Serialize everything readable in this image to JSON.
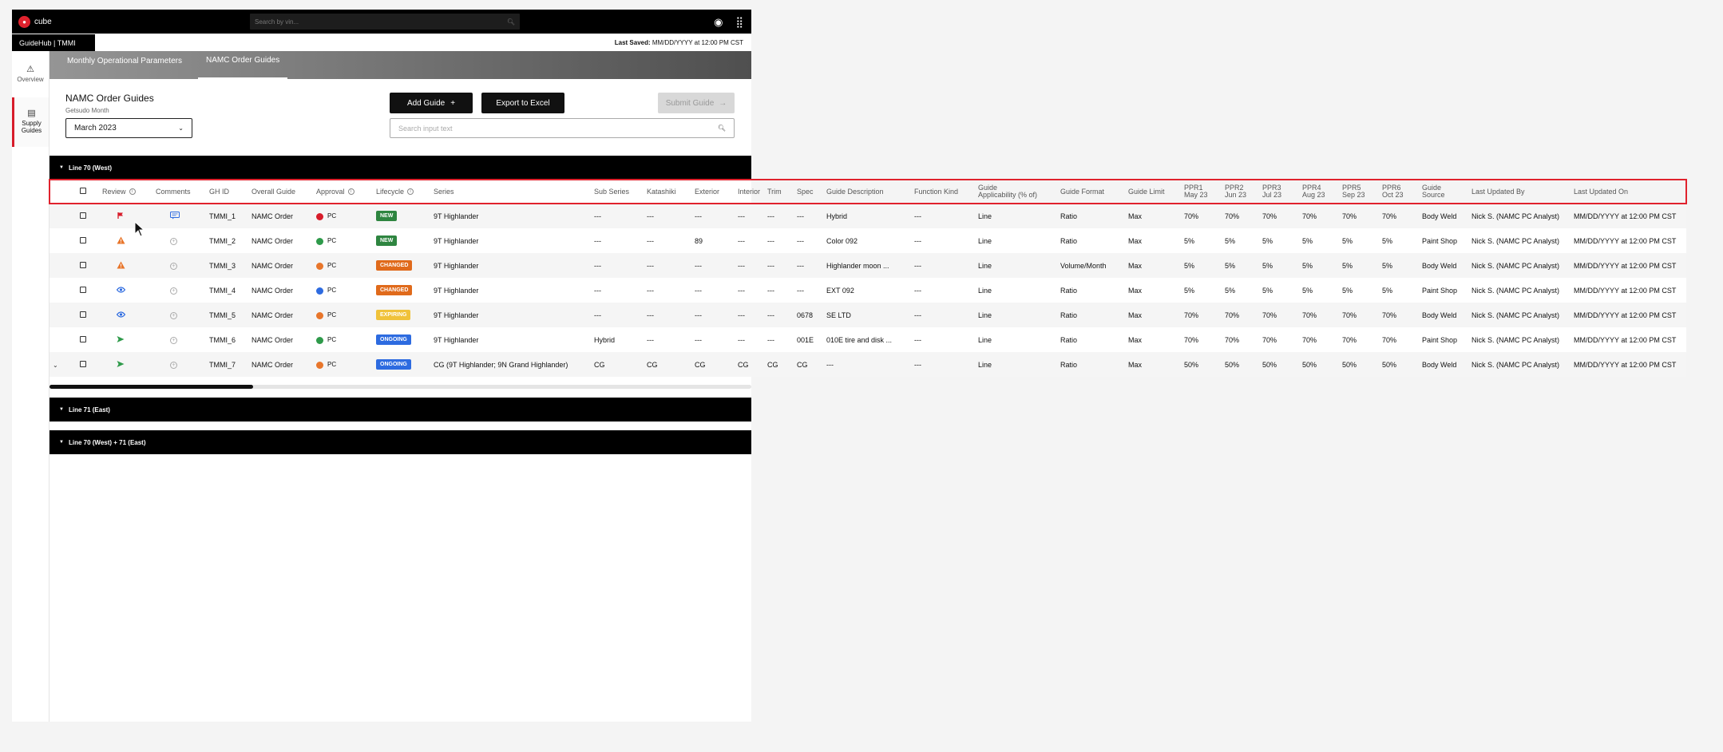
{
  "topbar": {
    "brand": "cube",
    "search_placeholder": "Search by vin...",
    "icons": [
      "user-circle-icon",
      "apps-grid-icon"
    ]
  },
  "subbar": {
    "app_name": "GuideHub | TMMI",
    "last_saved_label": "Last Saved:",
    "last_saved_value": "MM/DD/YYYY at 12:00 PM CST"
  },
  "sidebar": {
    "items": [
      {
        "label": "Overview",
        "icon": "overview-icon"
      },
      {
        "label": "Supply Guides",
        "icon": "document-icon"
      }
    ]
  },
  "tabs": [
    "Monthly Operational Parameters",
    "NAMC Order Guides"
  ],
  "panel": {
    "title": "NAMC Order Guides",
    "subtitle": "Getsudo Month",
    "month": "March 2023",
    "add_guide": "Add Guide",
    "export": "Export to Excel",
    "submit": "Submit Guide",
    "search_placeholder": "Search input text"
  },
  "groups": [
    "Line 70 (West)",
    "Line 71 (East)",
    "Line 70 (West) + 71 (East)"
  ],
  "table": {
    "headers": {
      "review": "Review",
      "comments": "Comments",
      "ghid": "GH ID",
      "overall": "Overall Guide",
      "approval": "Approval",
      "lifecycle": "Lifecycle",
      "series": "Series",
      "subseries": "Sub Series",
      "katashiki": "Katashiki",
      "exterior": "Exterior",
      "interior": "Interior",
      "trim": "Trim",
      "spec": "Spec",
      "desc": "Guide Description",
      "fkind": "Function Kind",
      "applic1": "Guide",
      "applic2": "Applicability (% of)",
      "format": "Guide Format",
      "limit": "Guide Limit",
      "ppr1a": "PPR1",
      "ppr1b": "May 23",
      "ppr2a": "PPR2",
      "ppr2b": "Jun 23",
      "ppr3a": "PPR3",
      "ppr3b": "Jul 23",
      "ppr4a": "PPR4",
      "ppr4b": "Aug 23",
      "ppr5a": "PPR5",
      "ppr5b": "Sep 23",
      "ppr6a": "PPR6",
      "ppr6b": "Oct 23",
      "source1": "Guide",
      "source2": "Source",
      "updated_by": "Last Updated By",
      "updated_on": "Last Updated On"
    },
    "rows": [
      {
        "review_icon": "flag-icon",
        "comment_icon": "chat-icon",
        "ghid": "TMMI_1",
        "overall": "NAMC Order",
        "approval_color": "#d71c2a",
        "approval": "PC",
        "lifecycle": "NEW",
        "lifecycle_color": "#2e8540",
        "series": "9T Highlander",
        "subseries": "---",
        "katashiki": "---",
        "exterior": "---",
        "interior": "---",
        "trim": "---",
        "spec": "---",
        "desc": "Hybrid",
        "fkind": "---",
        "applic": "Line",
        "format": "Ratio",
        "limit": "Max",
        "ppr": [
          "70%",
          "70%",
          "70%",
          "70%",
          "70%",
          "70%"
        ],
        "source": "Body Weld",
        "updated_by": "Nick S. (NAMC PC Analyst)",
        "updated_on": "MM/DD/YYYY at 12:00 PM CST"
      },
      {
        "review_icon": "warning-icon",
        "comment_icon": "add-comment-icon",
        "ghid": "TMMI_2",
        "overall": "NAMC Order",
        "approval_color": "#2e9a4a",
        "approval": "PC",
        "lifecycle": "NEW",
        "lifecycle_color": "#2e8540",
        "series": "9T Highlander",
        "subseries": "---",
        "katashiki": "---",
        "exterior": "89",
        "interior": "---",
        "trim": "---",
        "spec": "---",
        "desc": "Color 092",
        "fkind": "---",
        "applic": "Line",
        "format": "Ratio",
        "limit": "Max",
        "ppr": [
          "5%",
          "5%",
          "5%",
          "5%",
          "5%",
          "5%"
        ],
        "source": "Paint Shop",
        "updated_by": "Nick S. (NAMC PC Analyst)",
        "updated_on": "MM/DD/YYYY at 12:00 PM CST"
      },
      {
        "review_icon": "warning-icon",
        "comment_icon": "add-comment-icon",
        "ghid": "TMMI_3",
        "overall": "NAMC Order",
        "approval_color": "#e8762b",
        "approval": "PC",
        "lifecycle": "CHANGED",
        "lifecycle_color": "#e06a1b",
        "series": "9T Highlander",
        "subseries": "---",
        "katashiki": "---",
        "exterior": "---",
        "interior": "---",
        "trim": "---",
        "spec": "---",
        "desc": "Highlander moon ...",
        "fkind": "---",
        "applic": "Line",
        "format": "Volume/Month",
        "limit": "Max",
        "ppr": [
          "5%",
          "5%",
          "5%",
          "5%",
          "5%",
          "5%"
        ],
        "source": "Body Weld",
        "updated_by": "Nick S. (NAMC PC Analyst)",
        "updated_on": "MM/DD/YYYY at 12:00 PM CST"
      },
      {
        "review_icon": "eye-icon",
        "comment_icon": "add-comment-icon",
        "ghid": "TMMI_4",
        "overall": "NAMC Order",
        "approval_color": "#2d6be0",
        "approval": "PC",
        "lifecycle": "CHANGED",
        "lifecycle_color": "#e06a1b",
        "series": "9T Highlander",
        "subseries": "---",
        "katashiki": "---",
        "exterior": "---",
        "interior": "---",
        "trim": "---",
        "spec": "---",
        "desc": "EXT 092",
        "fkind": "---",
        "applic": "Line",
        "format": "Ratio",
        "limit": "Max",
        "ppr": [
          "5%",
          "5%",
          "5%",
          "5%",
          "5%",
          "5%"
        ],
        "source": "Paint Shop",
        "updated_by": "Nick S. (NAMC PC Analyst)",
        "updated_on": "MM/DD/YYYY at 12:00 PM CST"
      },
      {
        "review_icon": "eye-icon",
        "comment_icon": "add-comment-icon",
        "ghid": "TMMI_5",
        "overall": "NAMC Order",
        "approval_color": "#e8762b",
        "approval": "PC",
        "lifecycle": "EXPIRING",
        "lifecycle_color": "#f0c23a",
        "series": "9T Highlander",
        "subseries": "---",
        "katashiki": "---",
        "exterior": "---",
        "interior": "---",
        "trim": "---",
        "spec": "0678",
        "desc": "SE LTD",
        "fkind": "---",
        "applic": "Line",
        "format": "Ratio",
        "limit": "Max",
        "ppr": [
          "70%",
          "70%",
          "70%",
          "70%",
          "70%",
          "70%"
        ],
        "source": "Body Weld",
        "updated_by": "Nick S. (NAMC PC Analyst)",
        "updated_on": "MM/DD/YYYY at 12:00 PM CST"
      },
      {
        "review_icon": "send-icon",
        "comment_icon": "add-comment-icon",
        "ghid": "TMMI_6",
        "overall": "NAMC Order",
        "approval_color": "#2e9a4a",
        "approval": "PC",
        "lifecycle": "ONGOING",
        "lifecycle_color": "#2d6be0",
        "series": "9T Highlander",
        "subseries": "Hybrid",
        "katashiki": "---",
        "exterior": "---",
        "interior": "---",
        "trim": "---",
        "spec": "001E",
        "desc": "010E tire and disk ...",
        "fkind": "---",
        "applic": "Line",
        "format": "Ratio",
        "limit": "Max",
        "ppr": [
          "70%",
          "70%",
          "70%",
          "70%",
          "70%",
          "70%"
        ],
        "source": "Paint Shop",
        "updated_by": "Nick S. (NAMC PC Analyst)",
        "updated_on": "MM/DD/YYYY at 12:00 PM CST"
      },
      {
        "review_icon": "send-icon",
        "comment_icon": "add-comment-icon",
        "ghid": "TMMI_7",
        "overall": "NAMC Order",
        "approval_color": "#e8762b",
        "approval": "PC",
        "lifecycle": "ONGOING",
        "lifecycle_color": "#2d6be0",
        "series": "CG (9T Highlander; 9N Grand Highlander)",
        "subseries": "CG",
        "katashiki": "CG",
        "exterior": "CG",
        "interior": "CG",
        "trim": "CG",
        "spec": "CG",
        "desc": "---",
        "fkind": "---",
        "applic": "Line",
        "format": "Ratio",
        "limit": "Max",
        "ppr": [
          "50%",
          "50%",
          "50%",
          "50%",
          "50%",
          "50%"
        ],
        "source": "Body Weld",
        "updated_by": "Nick S. (NAMC PC Analyst)",
        "updated_on": "MM/DD/YYYY at 12:00 PM CST"
      }
    ]
  },
  "colors": {
    "accent": "#e0222d",
    "black": "#000000"
  }
}
